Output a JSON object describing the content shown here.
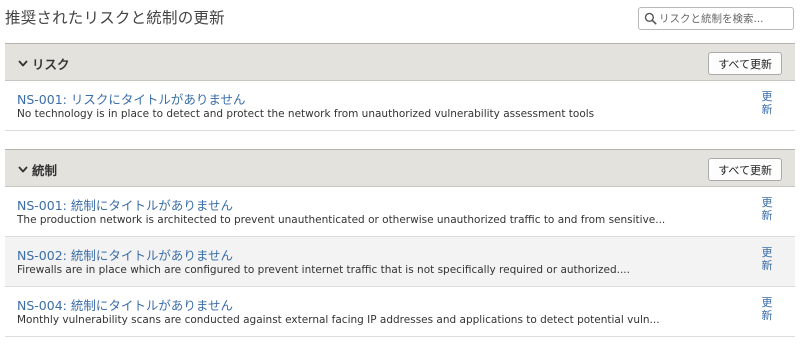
{
  "page": {
    "title": "推奨されたリスクと統制の更新"
  },
  "search": {
    "placeholder": "リスクと統制を検索..."
  },
  "sections": [
    {
      "title": "リスク",
      "update_all_label": "すべて更新",
      "items": [
        {
          "title": "NS-001: リスクにタイトルがありません",
          "description": "No technology is in place to detect and protect the network from unauthorized vulnerability assessment tools",
          "update_label": "更新"
        }
      ]
    },
    {
      "title": "統制",
      "update_all_label": "すべて更新",
      "items": [
        {
          "title": "NS-001: 統制にタイトルがありません",
          "description": "The production network is architected to prevent unauthenticated or otherwise unauthorized traffic to and from sensitive...",
          "update_label": "更新"
        },
        {
          "title": "NS-002: 統制にタイトルがありません",
          "description": "Firewalls are in place which are configured to prevent internet traffic that is not specifically required or authorized....",
          "update_label": "更新"
        },
        {
          "title": "NS-004: 統制にタイトルがありません",
          "description": "Monthly vulnerability scans are conducted against external facing IP addresses and applications to detect potential vuln...",
          "update_label": "更新"
        }
      ]
    }
  ],
  "colors": {
    "link": "#3b6ea8",
    "section_header_bg": "#e4e2dc",
    "alt_row_bg": "#f3f3f3"
  }
}
